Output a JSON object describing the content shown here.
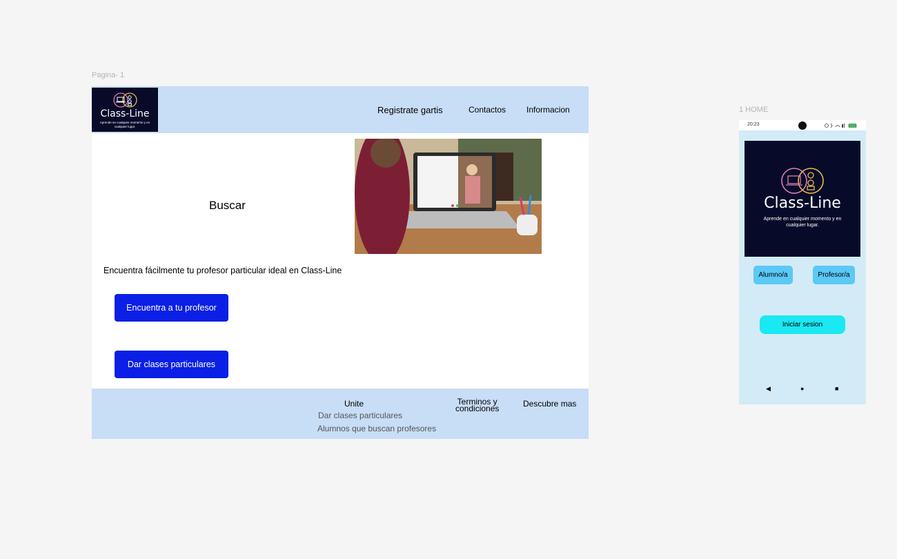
{
  "frames": {
    "desktop_label": "Pagina- 1",
    "mobile_label": "1 HOME"
  },
  "desktop": {
    "logo": {
      "title": "Class-Line",
      "tagline": "Aprende en cualquier momento y en cualquier lugar."
    },
    "nav": {
      "register": "Registrate gartis",
      "contacts": "Contactos",
      "info": "Informacion"
    },
    "search_title": "Buscar",
    "tagline": "Encuentra fácilmente tu profesor particular ideal en Class-Line",
    "buttons": {
      "find_teacher": "Encuentra a tu profesor",
      "give_classes": "Dar clases particulares"
    },
    "footer": {
      "join": "Unite",
      "give_classes": "Dar clases particulares",
      "students": "Alumnos que buscan profesores",
      "terms_line1": "Terminos y",
      "terms_line2": "condiciones",
      "discover": "Descubre mas"
    }
  },
  "mobile": {
    "status_time": "20:23",
    "logo": {
      "title": "Class-Line",
      "tagline": "Aprende en cualquier momento y en cualquier lugar."
    },
    "student_button": "Alumno/a",
    "teacher_button": "Profesor/a",
    "login_button": "Iniciar sesion",
    "nav_icons": [
      "back-icon",
      "home-icon",
      "recents-icon"
    ],
    "nav_glyphs": {
      "back": "◀",
      "home": "●",
      "recents": "■"
    }
  },
  "colors": {
    "header_bg": "#c8ddf6",
    "primary_button": "#0b1fe6",
    "logo_bg": "#070b29",
    "mobile_bg": "#d2ebf6",
    "mobile_button": "#5bc8f5",
    "login_button": "#1ae8f2"
  }
}
